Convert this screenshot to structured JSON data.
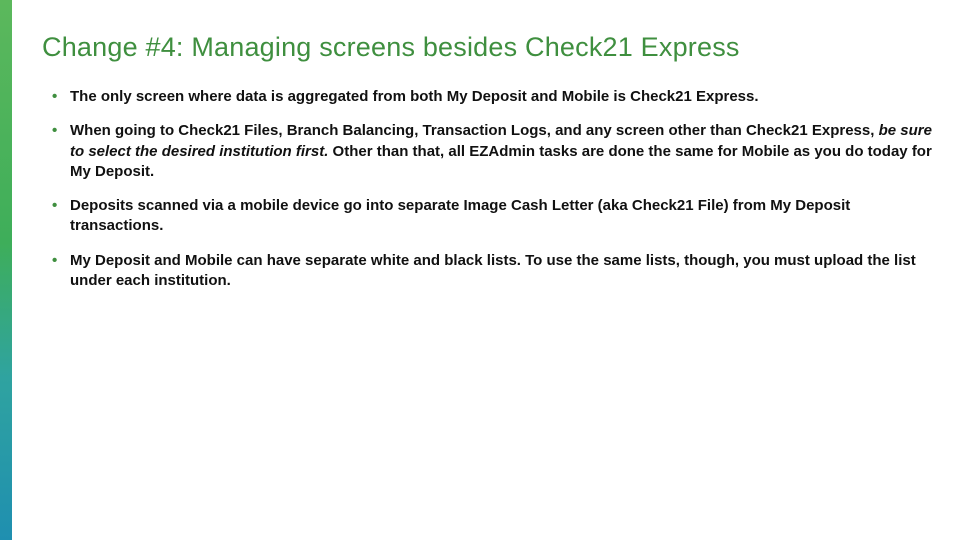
{
  "slide": {
    "title": "Change #4: Managing screens besides Check21 Express",
    "bullets": [
      {
        "text": "The only screen where data is aggregated from both My Deposit and Mobile is Check21 Express."
      },
      {
        "pre": "When going to Check21 Files, Branch Balancing, Transaction Logs, and any screen other than Check21 Express, ",
        "ital": "be sure to select the desired institution first.",
        "post": " Other than that, all EZAdmin tasks are done the same for Mobile as you do today for My Deposit."
      },
      {
        "text": "Deposits scanned via a mobile device go into separate Image Cash Letter (aka Check21 File) from My Deposit transactions."
      },
      {
        "text": "My Deposit and Mobile can have separate white and black lists. To use the same lists, though, you must upload the list under each institution."
      }
    ]
  }
}
